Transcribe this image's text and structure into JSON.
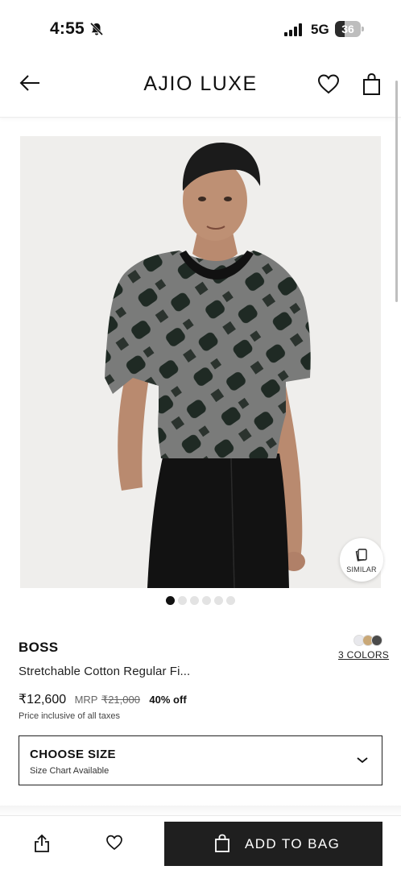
{
  "status_bar": {
    "time": "4:55",
    "network": "5G",
    "battery_level": "36",
    "battery_fraction": 0.36
  },
  "header": {
    "brand_logo": "AJIO LUXE",
    "back_icon": "arrow-left-icon",
    "wishlist_icon": "heart-icon",
    "bag_icon": "shopping-bag-icon"
  },
  "gallery": {
    "image_count": 6,
    "active_index": 0,
    "similar_label": "SIMILAR"
  },
  "product": {
    "brand": "BOSS",
    "title": "Stretchable Cotton Regular Fi...",
    "price": "₹12,600",
    "mrp_label": "MRP",
    "mrp_value": "₹21,000",
    "discount": "40% off",
    "tax_note": "Price inclusive of all taxes",
    "colors_link": "3 COLORS",
    "swatch_colors": [
      "#e8e8ec",
      "#c9a877",
      "#4a4a4a"
    ]
  },
  "size_selector": {
    "title": "CHOOSE SIZE",
    "subtitle": "Size Chart Available"
  },
  "bottom_bar": {
    "add_to_bag_label": "ADD TO BAG",
    "button_color": "#1f1f1f"
  }
}
